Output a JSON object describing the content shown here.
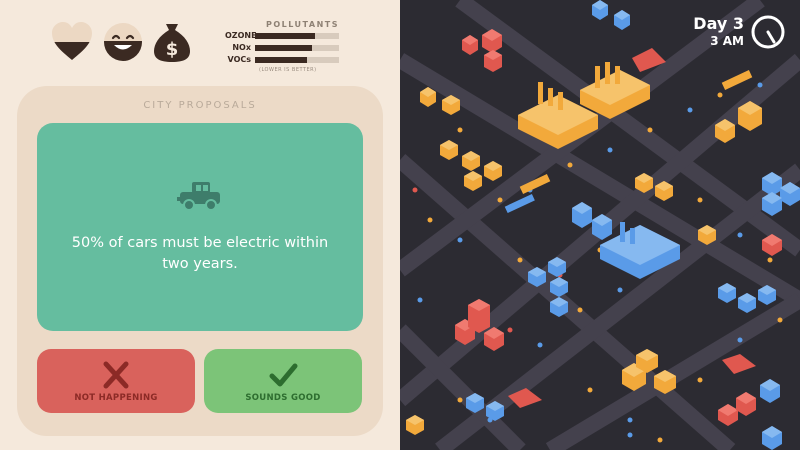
{
  "stats": {
    "icons": [
      "heart-icon",
      "face-icon",
      "money-bag-icon"
    ],
    "money_symbol": "$"
  },
  "pollutants": {
    "title": "POLLUTANTS",
    "note": "(LOWER IS BETTER)",
    "items": [
      {
        "label": "OZONE",
        "level": 0.72
      },
      {
        "label": "NOx",
        "level": 0.68
      },
      {
        "label": "VOCs",
        "level": 0.62
      }
    ]
  },
  "proposals": {
    "title": "CITY PROPOSALS",
    "icon": "car-icon",
    "text": "50% of cars must be electric within two years.",
    "reject_label": "NOT HAPPENING",
    "accept_label": "SOUNDS GOOD",
    "reject_icon": "x-icon",
    "accept_icon": "check-icon"
  },
  "hud": {
    "day": "Day 3",
    "time": "3 AM",
    "clock_icon": "clock-icon"
  },
  "colors": {
    "panel_bg": "#f5e9dc",
    "card_bg": "#65bd9f",
    "reject": "#d9625c",
    "accept": "#7cc478",
    "map_bg": "#2c2b32",
    "road": "#44414d",
    "red_building": "#e0584f",
    "orange_building": "#f2a93b",
    "blue_building": "#5a9be8"
  }
}
